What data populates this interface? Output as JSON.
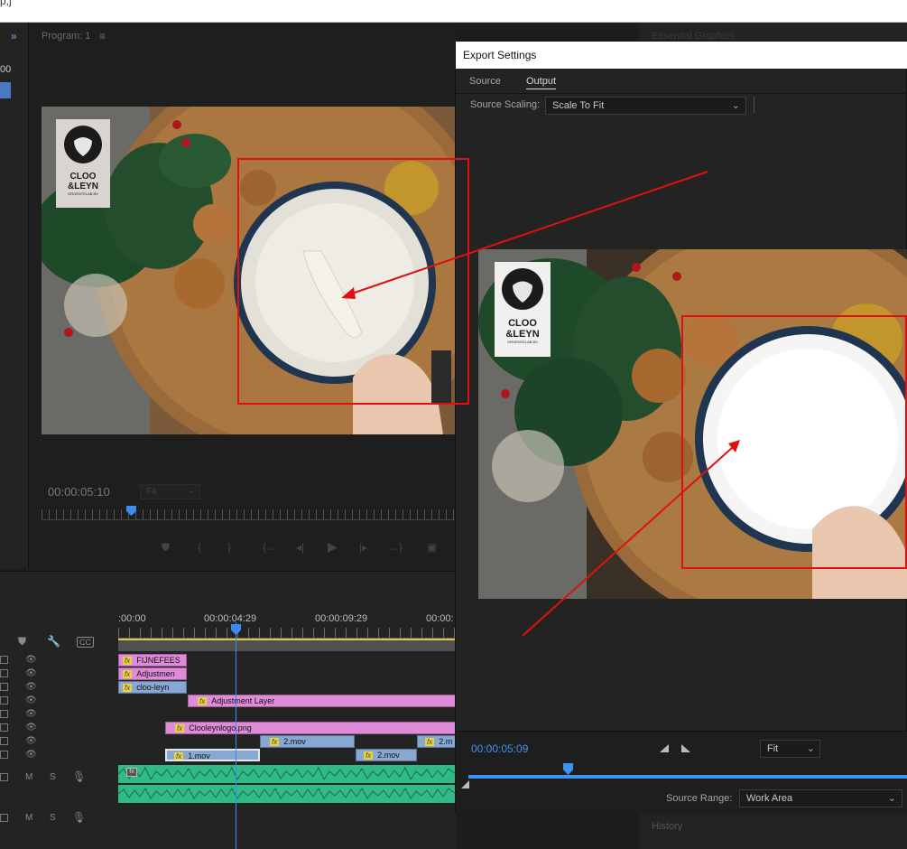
{
  "top": {
    "fragment": "p,j"
  },
  "left_panel": {
    "chevron": "»",
    "number": "00"
  },
  "program": {
    "title": "Program: 1",
    "menu_icon": "≡",
    "timecode": "00:00:05:10",
    "fit": "Fit",
    "logo": {
      "line1": "CLOO",
      "line2": "&LEYN",
      "line3": "GROENTELAB BV"
    }
  },
  "controls": [
    "add-marker-icon",
    "mark-in-icon",
    "mark-out-icon",
    "go-to-in-icon",
    "step-back-icon",
    "play-icon",
    "step-forward-icon",
    "go-to-out-icon",
    "export-frame-icon"
  ],
  "timeline": {
    "ticks": [
      ":00:00",
      "00:00:04:29",
      "00:00:09:29",
      "00:00:"
    ],
    "clips": [
      {
        "label": "FIJNEFEES",
        "color": "pink",
        "fx": "fx"
      },
      {
        "label": "Adjustmen",
        "color": "pink",
        "fx": "fx"
      },
      {
        "label": "cloo-leyn",
        "color": "blue",
        "fx": "fx"
      },
      {
        "label": "Adjustment Layer",
        "color": "pink",
        "fx": "fx"
      },
      {
        "label": "Clooleynlogo.png",
        "color": "pink",
        "fx": "fx"
      },
      {
        "label": "2.mov",
        "color": "blue",
        "fx": "fx"
      },
      {
        "label": "2.m",
        "color": "blue",
        "fx": "fx"
      },
      {
        "label": "1.mov",
        "color": "blue",
        "fx": "fx"
      },
      {
        "label": "2.mov",
        "color": "blue",
        "fx": "fx"
      }
    ],
    "audio_labels": {
      "mute": "M",
      "solo": "S"
    }
  },
  "right_panels": {
    "essential_graphics": "Essential Graphics",
    "history": "History"
  },
  "export": {
    "title": "Export Settings",
    "tabs": [
      "Source",
      "Output"
    ],
    "active_tab": "Output",
    "source_scaling_label": "Source Scaling:",
    "source_scaling_value": "Scale To Fit",
    "timecode": "00:00:05:09",
    "fit": "Fit",
    "source_range_label": "Source Range:",
    "source_range_value": "Work Area"
  },
  "colors": {
    "accent": "#3d93f5",
    "annotation": "#e01010",
    "clip_pink": "#e08bd9",
    "clip_blue": "#86a8d3",
    "audio": "#2fba86"
  }
}
